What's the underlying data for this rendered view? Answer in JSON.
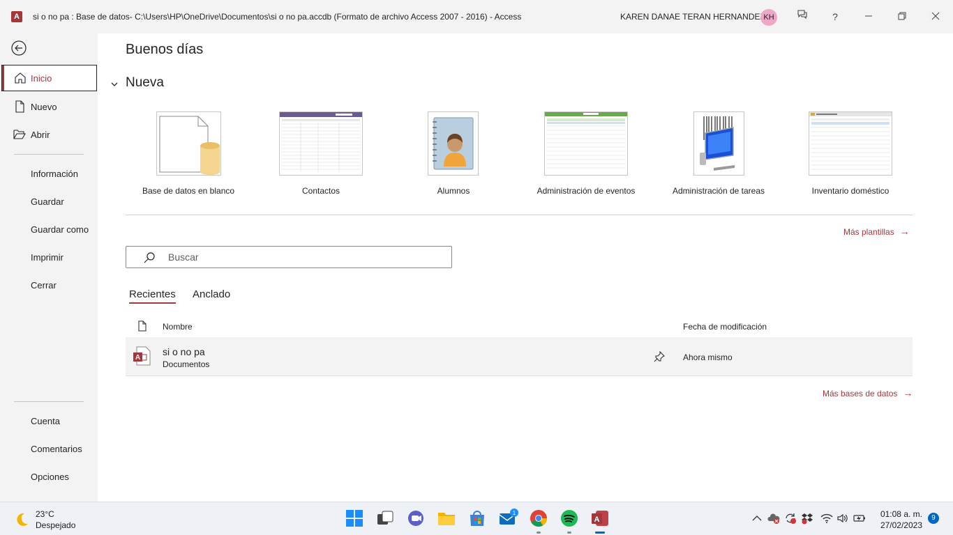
{
  "window": {
    "title": "si o no pa : Base de datos- C:\\Users\\HP\\OneDrive\\Documentos\\si o no pa.accdb (Formato de archivo Access 2007 - 2016)  -  Access",
    "user_name": "KAREN DANAE TERAN HERNANDEZ",
    "user_initials": "KH",
    "app_icon_letter": "A",
    "help_label": "?"
  },
  "sidebar": {
    "items": [
      {
        "label": "Inicio",
        "icon": "home-icon",
        "active": true
      },
      {
        "label": "Nuevo",
        "icon": "new-file-icon"
      },
      {
        "label": "Abrir",
        "icon": "folder-open-icon"
      },
      {
        "label": "Información"
      },
      {
        "label": "Guardar"
      },
      {
        "label": "Guardar como"
      },
      {
        "label": "Imprimir"
      },
      {
        "label": "Cerrar"
      },
      {
        "label": "Cuenta"
      },
      {
        "label": "Comentarios"
      },
      {
        "label": "Opciones"
      }
    ]
  },
  "main": {
    "greeting": "Buenos días",
    "new_section_title": "Nueva",
    "templates": [
      {
        "name": "Base de datos en blanco"
      },
      {
        "name": "Contactos"
      },
      {
        "name": "Alumnos"
      },
      {
        "name": "Administración de eventos"
      },
      {
        "name": "Administración de tareas"
      },
      {
        "name": "Inventario doméstico"
      }
    ],
    "more_templates": "Más plantillas",
    "search_placeholder": "Buscar",
    "tabs": [
      {
        "label": "Recientes",
        "active": true
      },
      {
        "label": "Anclado"
      }
    ],
    "list_header": {
      "name": "Nombre",
      "date": "Fecha de modificación"
    },
    "recent_files": [
      {
        "name": "si o no pa",
        "location": "Documentos",
        "modified": "Ahora mismo"
      }
    ],
    "more_databases": "Más bases de datos"
  },
  "taskbar": {
    "weather_temp": "23°C",
    "weather_condition": "Despejado",
    "mail_badge": "1",
    "time": "01:08 a. m.",
    "date": "27/02/2023",
    "notifications": "9"
  },
  "colors": {
    "accent": "#a4373a",
    "sidebar_bg": "#f3f3f3",
    "taskbar_bg": "#eef1f6"
  }
}
